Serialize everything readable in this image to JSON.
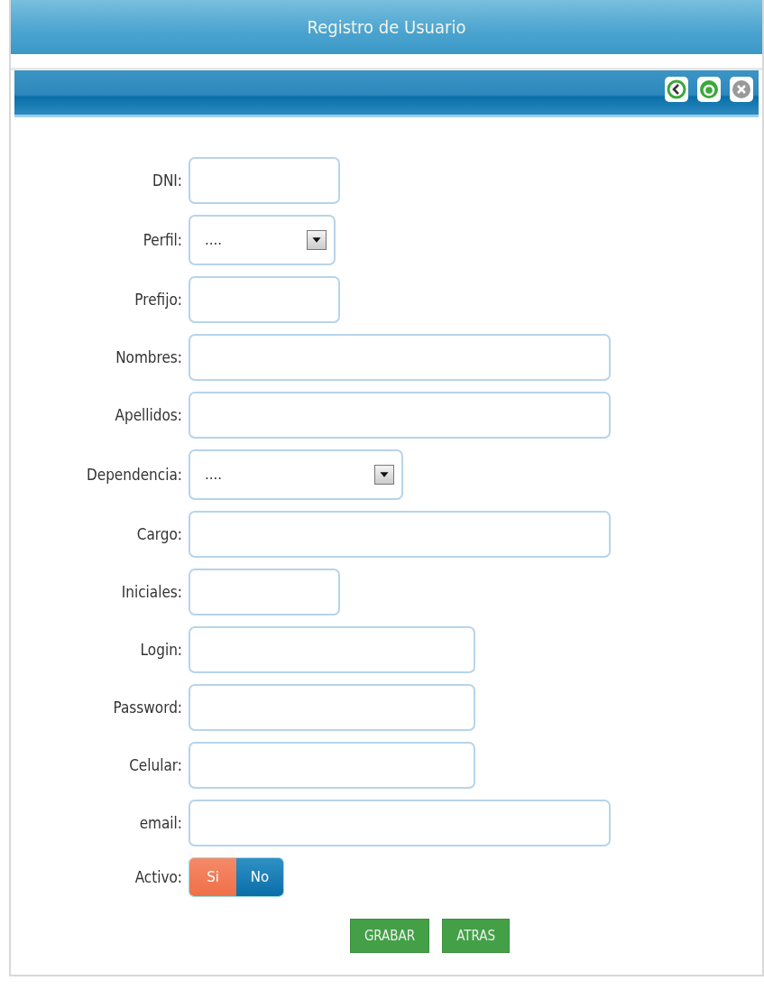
{
  "window": {
    "title": "Registro de Usuario"
  },
  "toolbar": {
    "icons": [
      {
        "kind": "back"
      },
      {
        "kind": "refresh"
      },
      {
        "kind": "close"
      }
    ]
  },
  "fields": [
    {
      "label": "DNI:",
      "kind": "text"
    },
    {
      "label": "Perfil:",
      "kind": "select",
      "value": "...."
    },
    {
      "label": "Prefijo:",
      "kind": "text"
    },
    {
      "label": "Nombres:",
      "kind": "text"
    },
    {
      "label": "Apellidos:",
      "kind": "text"
    },
    {
      "label": "Dependencia:",
      "kind": "select",
      "value": "...."
    },
    {
      "label": "Cargo:",
      "kind": "text"
    },
    {
      "label": "Iniciales:",
      "kind": "text"
    },
    {
      "label": "Login:",
      "kind": "text"
    },
    {
      "label": "Password:",
      "kind": "text"
    },
    {
      "label": "Celular:",
      "kind": "text"
    },
    {
      "label": "email:",
      "kind": "text"
    }
  ],
  "active": {
    "label": "Activo:",
    "options": [
      {
        "label": "Si",
        "selected": true
      },
      {
        "label": "No",
        "selected": false
      }
    ]
  },
  "buttons": [
    "GRABAR",
    "ATRAS"
  ]
}
